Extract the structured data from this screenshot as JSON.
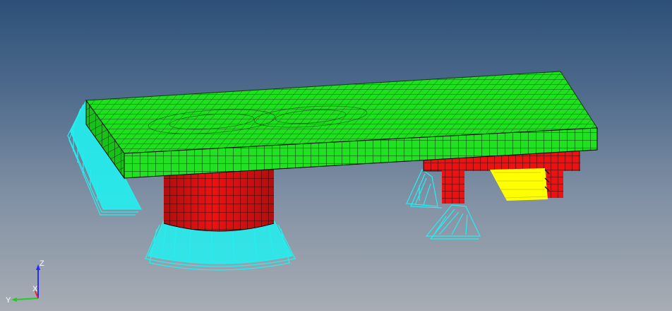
{
  "viewport": {
    "colors": {
      "background_top": "#2d5078",
      "background_bottom": "#a8adb4",
      "deck": "#1fe01f",
      "pier": "#ee1111",
      "support": "#22f0f0",
      "load": "#ffff00",
      "mesh_line": "#000000"
    }
  },
  "model": {
    "parts": [
      {
        "name": "deck",
        "color": "#1fe01f"
      },
      {
        "name": "cylindrical-pier",
        "color": "#ee1111"
      },
      {
        "name": "frame-pier",
        "color": "#ee1111"
      },
      {
        "name": "support-constraints",
        "color": "#22f0f0"
      },
      {
        "name": "applied-load",
        "color": "#ffff00"
      }
    ]
  },
  "triad": {
    "x_label": "X",
    "y_label": "Y",
    "z_label": "Z"
  }
}
